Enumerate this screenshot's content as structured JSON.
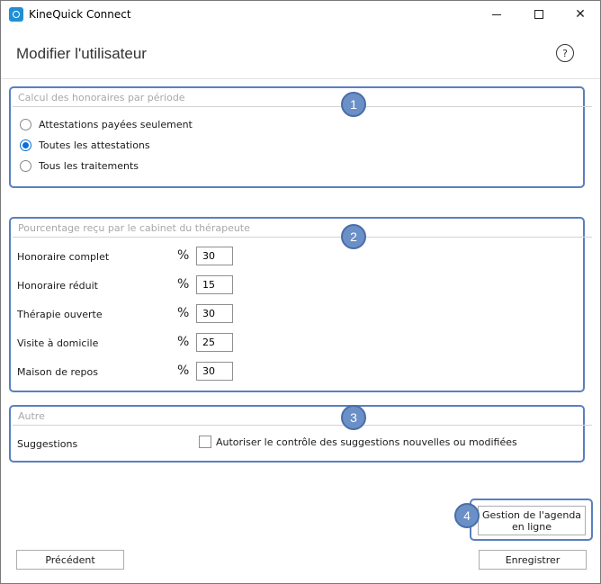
{
  "window": {
    "title": "KineQuick Connect",
    "min_icon": "minimize-icon",
    "max_icon": "maximize-icon",
    "close_icon": "close-icon",
    "close_glyph": "✕"
  },
  "header": {
    "title": "Modifier l'utilisateur",
    "help_glyph": "?"
  },
  "sections": {
    "fees": {
      "legend": "Calcul des honoraires par période",
      "badge": "1",
      "options": [
        {
          "label": "Attestations payées seulement",
          "checked": false
        },
        {
          "label": "Toutes les attestations",
          "checked": true
        },
        {
          "label": "Tous les traitements",
          "checked": false
        }
      ]
    },
    "percent": {
      "legend": "Pourcentage reçu par le cabinet du thérapeute",
      "badge": "2",
      "symbol": "%",
      "rows": [
        {
          "label": "Honoraire complet",
          "value": "30"
        },
        {
          "label": "Honoraire réduit",
          "value": "15"
        },
        {
          "label": "Thérapie ouverte",
          "value": "30"
        },
        {
          "label": "Visite à domicile",
          "value": "25"
        },
        {
          "label": "Maison de repos",
          "value": "30"
        }
      ]
    },
    "other": {
      "legend": "Autre",
      "badge": "3",
      "suggestions_label": "Suggestions",
      "checkbox_label": "Autoriser le contrôle des suggestions nouvelles ou modifiées",
      "checked": false
    }
  },
  "agenda": {
    "badge": "4",
    "button_line1": "Gestion de l'agenda",
    "button_line2": "en ligne"
  },
  "footer": {
    "previous_label": "Précédent",
    "save_label": "Enregistrer"
  },
  "colors": {
    "accent": "#0a6fd6",
    "annotation_border": "#5a7fc0",
    "badge_fill": "#6b8fc7"
  }
}
